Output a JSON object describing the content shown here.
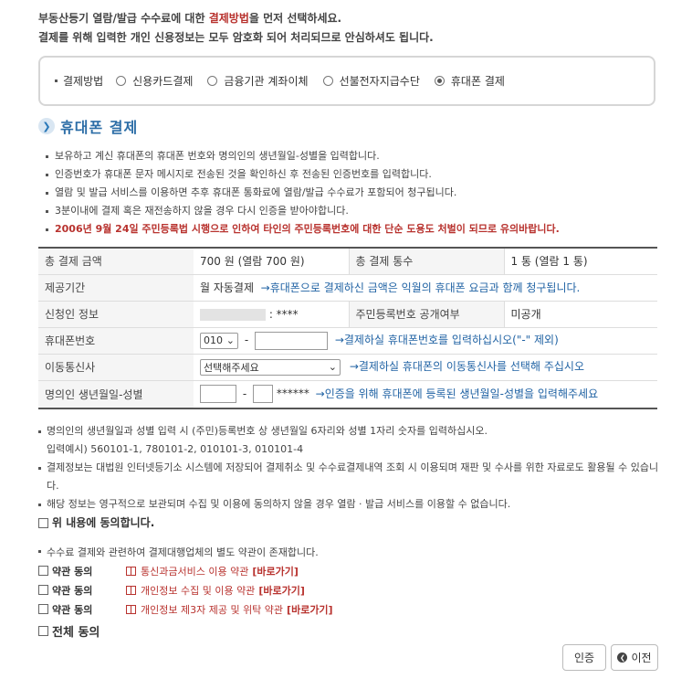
{
  "intro": {
    "line1_pre": "부동산등기 열람/발급 수수료에 대한 ",
    "line1_accent": "결제방법",
    "line1_post": "을 먼저 선택하세요.",
    "line2": "결제를 위해 입력한 개인 신용정보는 모두 암호화 되어 처리되므로 안심하셔도 됩니다."
  },
  "payment_method": {
    "label": "결제방법",
    "options": [
      "신용카드결제",
      "금융기관 계좌이체",
      "선불전자지급수단",
      "휴대폰 결제"
    ],
    "selected": "휴대폰 결제"
  },
  "section_title": "휴대폰 결제",
  "guide": [
    "보유하고 계신 휴대폰의 휴대폰 번호와 명의인의 생년월일-성별을 입력합니다.",
    "인증번호가 휴대폰 문자 메시지로 전송된 것을 확인하신 후 전송된 인증번호를 입력합니다.",
    "열람 및 발급 서비스를 이용하면 추후 휴대폰 통화료에 열람/발급 수수료가 포함되어 청구됩니다.",
    "3분이내에 결제 혹은 재전송하지 않을 경우 다시 인증을 받아야합니다."
  ],
  "guide_warning": "2006년 9월 24일 주민등록법 시행으로 인하여 타인의 주민등록번호에 대한 단순 도용도 처벌이 되므로 유의바랍니다.",
  "table": {
    "total_amount_label": "총 결제 금액",
    "total_amount_value": "700 원 (열람 700 원)",
    "total_count_label": "총 결제 통수",
    "total_count_value": "1 통 (열람 1 통)",
    "period_label": "제공기간",
    "period_value": "월 자동결제",
    "period_note": "→휴대폰으로 결제하신 금액은 익월의 휴대폰 요금과 함께 청구됩니다.",
    "applicant_label": "신청인 정보",
    "applicant_suffix": ": ****",
    "rrn_public_label": "주민등록번호 공개여부",
    "rrn_public_value": "미공개",
    "phone_label": "휴대폰번호",
    "phone_prefix": "010",
    "phone_dash": "-",
    "phone_note": "→결제하실 휴대폰번호를 입력하십시오(\"-\" 제외)",
    "carrier_label": "이동통신사",
    "carrier_select": "선택해주세요",
    "carrier_note": "→결제하실 휴대폰의 이동통신사를 선택해 주십시오",
    "birth_label": "명의인 생년월일-성별",
    "birth_dash": "-",
    "birth_mask": "******",
    "birth_note": "→인증을 위해 휴대폰에 등록된 생년월일-성별을 입력해주세요"
  },
  "notes": [
    "명의인의 생년월일과 성별 입력 시 (주민)등록번호 상 생년월일 6자리와 성별 1자리 숫자를 입력하십시오.",
    "결제정보는 대법원 인터넷등기소 시스템에 저장되어 결제취소 및 수수료결제내역 조회 시 이용되며 재판 및 수사를 위한 자료로도 활용될 수 있습니다.",
    "해당 정보는 영구적으로 보관되며 수집 및 이용에 동의하지 않을 경우 열람 · 발급 서비스를 이용할 수 없습니다."
  ],
  "note_example": "입력예시) 560101-1, 780101-2, 010101-3, 010101-4",
  "agree_label": "위 내용에 동의합니다.",
  "terms_intro": "수수료 결제와 관련하여 결제대행업체의 별도 약관이 존재합니다.",
  "terms": [
    {
      "agree": "약관 동의",
      "title": "통신과금서비스 이용 약관",
      "link": "[바로가기]"
    },
    {
      "agree": "약관 동의",
      "title": "개인정보 수집 및 이용 약관",
      "link": "[바로가기]"
    },
    {
      "agree": "약관 동의",
      "title": "개인정보 제3자 제공 및 위탁 약관",
      "link": "[바로가기]"
    }
  ],
  "all_agree": "전체 동의",
  "buttons": {
    "cert": "인증",
    "prev": "이전"
  },
  "colors": {
    "accent": "#b8322e",
    "blue": "#2163a4",
    "title": "#2d6ea7"
  }
}
